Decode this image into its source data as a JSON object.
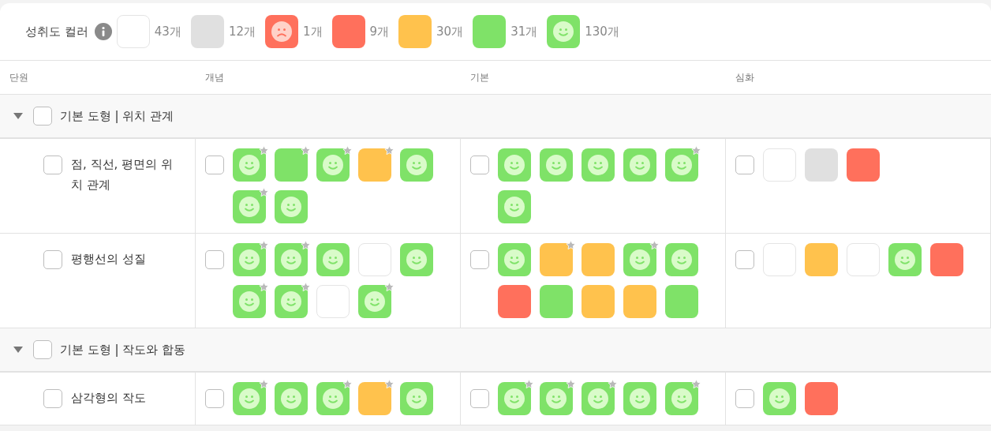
{
  "legend": {
    "label": "성취도 컬러",
    "items": [
      {
        "kind": "blank",
        "count": "43개"
      },
      {
        "kind": "gray",
        "count": "12개"
      },
      {
        "kind": "sad",
        "count": "1개"
      },
      {
        "kind": "red",
        "count": "9개"
      },
      {
        "kind": "orange",
        "count": "30개"
      },
      {
        "kind": "green",
        "count": "31개"
      },
      {
        "kind": "smile",
        "count": "130개"
      }
    ]
  },
  "columns": [
    "단원",
    "개념",
    "기본",
    "심화"
  ],
  "groups": [
    {
      "title": "기본 도형 | 위치 관계",
      "expanded": true,
      "checked": false,
      "units": [
        {
          "name": "점, 직선, 평면의 위치 관계",
          "checked": false,
          "cells": [
            {
              "checked": false,
              "tiles": [
                {
                  "kind": "smile",
                  "starred": true
                },
                {
                  "kind": "green",
                  "starred": true
                },
                {
                  "kind": "smile",
                  "starred": true
                },
                {
                  "kind": "orange",
                  "starred": true
                },
                {
                  "kind": "smile",
                  "starred": false
                },
                {
                  "kind": "smile",
                  "starred": true
                },
                {
                  "kind": "smile",
                  "starred": false
                }
              ]
            },
            {
              "checked": false,
              "tiles": [
                {
                  "kind": "smile",
                  "starred": false
                },
                {
                  "kind": "smile",
                  "starred": false
                },
                {
                  "kind": "smile",
                  "starred": false
                },
                {
                  "kind": "smile",
                  "starred": false
                },
                {
                  "kind": "smile",
                  "starred": true
                },
                {
                  "kind": "smile",
                  "starred": false
                }
              ]
            },
            {
              "checked": false,
              "tiles": [
                {
                  "kind": "blank",
                  "starred": false
                },
                {
                  "kind": "gray",
                  "starred": false
                },
                {
                  "kind": "red",
                  "starred": false
                }
              ]
            }
          ]
        },
        {
          "name": "평행선의 성질",
          "checked": false,
          "cells": [
            {
              "checked": false,
              "tiles": [
                {
                  "kind": "smile",
                  "starred": true
                },
                {
                  "kind": "smile",
                  "starred": true
                },
                {
                  "kind": "smile",
                  "starred": false
                },
                {
                  "kind": "blank",
                  "starred": false
                },
                {
                  "kind": "smile",
                  "starred": false
                },
                {
                  "kind": "smile",
                  "starred": true
                },
                {
                  "kind": "smile",
                  "starred": true
                },
                {
                  "kind": "blank",
                  "starred": false
                },
                {
                  "kind": "smile",
                  "starred": true
                }
              ]
            },
            {
              "checked": false,
              "tiles": [
                {
                  "kind": "smile",
                  "starred": false
                },
                {
                  "kind": "orange",
                  "starred": true
                },
                {
                  "kind": "orange",
                  "starred": false
                },
                {
                  "kind": "smile",
                  "starred": true
                },
                {
                  "kind": "smile",
                  "starred": false
                },
                {
                  "kind": "red",
                  "starred": false
                },
                {
                  "kind": "green",
                  "starred": false
                },
                {
                  "kind": "orange",
                  "starred": false
                },
                {
                  "kind": "orange",
                  "starred": false
                },
                {
                  "kind": "green",
                  "starred": false
                }
              ]
            },
            {
              "checked": false,
              "tiles": [
                {
                  "kind": "blank",
                  "starred": false
                },
                {
                  "kind": "orange",
                  "starred": false
                },
                {
                  "kind": "blank",
                  "starred": false
                },
                {
                  "kind": "smile",
                  "starred": false
                },
                {
                  "kind": "red",
                  "starred": false
                }
              ]
            }
          ]
        }
      ]
    },
    {
      "title": "기본 도형 | 작도와 합동",
      "expanded": true,
      "checked": false,
      "units": [
        {
          "name": "삼각형의 작도",
          "checked": false,
          "cells": [
            {
              "checked": false,
              "tiles": [
                {
                  "kind": "smile",
                  "starred": true
                },
                {
                  "kind": "smile",
                  "starred": false
                },
                {
                  "kind": "smile",
                  "starred": true
                },
                {
                  "kind": "orange",
                  "starred": true
                },
                {
                  "kind": "smile",
                  "starred": false
                }
              ]
            },
            {
              "checked": false,
              "tiles": [
                {
                  "kind": "smile",
                  "starred": true
                },
                {
                  "kind": "smile",
                  "starred": true
                },
                {
                  "kind": "smile",
                  "starred": true
                },
                {
                  "kind": "smile",
                  "starred": false
                },
                {
                  "kind": "smile",
                  "starred": true
                }
              ]
            },
            {
              "checked": false,
              "tiles": [
                {
                  "kind": "smile",
                  "starred": false
                },
                {
                  "kind": "red",
                  "starred": false
                }
              ]
            }
          ]
        }
      ]
    }
  ]
}
